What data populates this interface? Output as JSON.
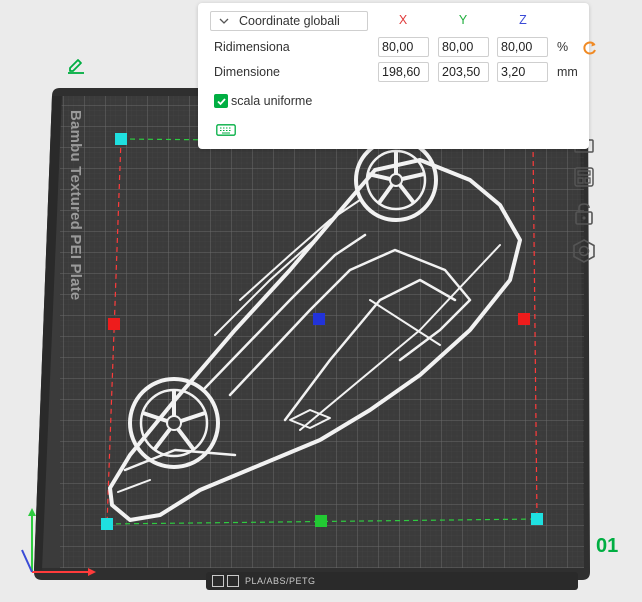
{
  "scale_panel": {
    "coord_system": "Coordinate globali",
    "axes": {
      "x": "X",
      "y": "Y",
      "z": "Z"
    },
    "axis_colors": {
      "x": "#e03c3c",
      "y": "#1fae3c",
      "z": "#3a4bd6"
    },
    "scale": {
      "label": "Ridimensiona",
      "x": "80,00",
      "y": "80,00",
      "z": "80,00",
      "unit": "%"
    },
    "size": {
      "label": "Dimensione",
      "x": "198,60",
      "y": "203,50",
      "z": "3,20",
      "unit": "mm"
    },
    "uniform_scale": {
      "label": "scala uniforme",
      "checked": true
    }
  },
  "viewport": {
    "plate_name": "Bambu Textured PEI Plate",
    "plate_number": "01",
    "filament_info": "PLA/ABS/PETG",
    "tools": [
      "arrange-icon",
      "layout-icon",
      "lock-icon",
      "settings-icon"
    ]
  },
  "colors": {
    "accent": "#00ae42",
    "plate": "#3a3a3a",
    "reset": "#f08a24"
  }
}
